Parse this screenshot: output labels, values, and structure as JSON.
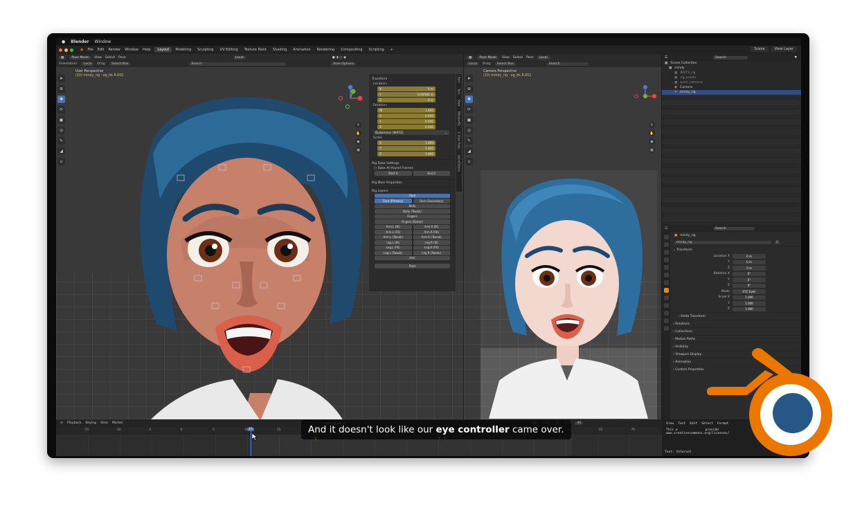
{
  "macbar": {
    "apple": "",
    "app": "Blender",
    "menu": "Window"
  },
  "topbar": {
    "menus": [
      "File",
      "Edit",
      "Render",
      "Window",
      "Help"
    ],
    "workspaces": [
      "Layout",
      "Modeling",
      "Sculpting",
      "UV Editing",
      "Texture Paint",
      "Shading",
      "Animation",
      "Rendering",
      "Compositing",
      "Scripting"
    ],
    "active_workspace": "Layout",
    "scene": "Scene",
    "view_layer": "View Layer"
  },
  "left_viewport": {
    "mode": "Pose Mode",
    "menus": [
      "View",
      "Select",
      "Pose"
    ],
    "orientation_label": "Orientation:",
    "orientation": "Local",
    "drag_label": "Drag:",
    "drag": "Select Box",
    "transform": "Local",
    "search_placeholder": "Search",
    "perspective": "User Perspective",
    "object_line": "(10) mindy_rig : eg_bk.R.002",
    "pose_options": "Pose Options"
  },
  "right_viewport": {
    "mode": "Pose Mode",
    "menus": [
      "View",
      "Select",
      "Pose"
    ],
    "orientation": "Local",
    "drag_label": "Drag:",
    "drag": "Select Box",
    "transform": "Local",
    "search_placeholder": "Search",
    "perspective": "Camera Perspective",
    "object_line": "(10) mindy_rig : eg_bk.R.002"
  },
  "npanel": {
    "transform_title": "Transform",
    "location_label": "Location:",
    "location": [
      {
        "k": "X",
        "v": "0 m"
      },
      {
        "k": "Y",
        "v": "0.00582 m"
      },
      {
        "k": "Z",
        "v": "0 m"
      }
    ],
    "rotation_label": "Rotation:",
    "rotation": [
      {
        "k": "W",
        "v": "1.000"
      },
      {
        "k": "X",
        "v": "0.000"
      },
      {
        "k": "Y",
        "v": "0.000"
      },
      {
        "k": "Z",
        "v": "0.000"
      }
    ],
    "rotation_mode": "Quaternion (WXYZ)",
    "scale_label": "Scale:",
    "scale": [
      {
        "k": "X",
        "v": "1.000"
      },
      {
        "k": "Y",
        "v": "1.000"
      },
      {
        "k": "Z",
        "v": "1.000"
      }
    ],
    "rig_bake_title": "Rig Bake Settings",
    "bake_all": "Bake All Keyed Frames",
    "start": "Start",
    "start_val": "0",
    "end": "End",
    "end_val": "0",
    "rig_main_title": "Rig Main Properties",
    "rig_layers_title": "Rig Layers",
    "layers": {
      "face": "Face",
      "face_primary": "Face (Primary)",
      "face_secondary": "Face (Secondary)",
      "body": "Body",
      "body_tweak": "Body (Tweak)",
      "fingers": "Fingers",
      "fingers_detail": "Fingers (Detail)",
      "arm_l_ik": "Arm.L (IK)",
      "arm_r_ik": "Arm.R (IK)",
      "arm_l_fk": "Arm.L (FK)",
      "arm_r_fk": "Arm.R (FK)",
      "arm_l_tweak": "Arm.L (Tweak)",
      "arm_r_tweak": "Arm.R (Tweak)",
      "leg_l_ik": "Leg.L (IK)",
      "leg_r_ik": "Leg.R (IK)",
      "leg_l_fk": "Leg.L (FK)",
      "leg_r_fk": "Leg.R (FK)",
      "leg_l_tweak": "Leg.L (Tweak)",
      "leg_r_tweak": "Leg.R (Tweak)",
      "hair": "Hair",
      "root": "Root"
    },
    "tabs": [
      "Item",
      "Tool",
      "View",
      "BlenderKit",
      "3. Pose Tools",
      "AnimEditors"
    ]
  },
  "outliner": {
    "search_placeholder": "Search",
    "rows": [
      "Scene Collection",
      "mindy",
      "WGTS_rig",
      "rig_assets",
      "pose_cameras",
      "Camera",
      "mindy_rig"
    ]
  },
  "properties": {
    "search_placeholder": "Search",
    "object": "mindy_rig",
    "data": "mindy_rig",
    "users": "2",
    "transform_title": "Transform",
    "location": [
      {
        "k": "Location X",
        "v": "0 m"
      },
      {
        "k": "Y",
        "v": "0 m"
      },
      {
        "k": "Z",
        "v": "0 m"
      }
    ],
    "rotation": [
      {
        "k": "Rotation X",
        "v": "0°"
      },
      {
        "k": "Y",
        "v": "0°"
      },
      {
        "k": "Z",
        "v": "0°"
      }
    ],
    "mode_label": "Mode",
    "mode": "XYZ Euler",
    "scale": [
      {
        "k": "Scale X",
        "v": "1.000"
      },
      {
        "k": "Y",
        "v": "1.000"
      },
      {
        "k": "Z",
        "v": "1.000"
      }
    ],
    "sections": [
      "Delta Transform",
      "Relations",
      "Collections",
      "Motion Paths",
      "Visibility",
      "Viewport Display",
      "Animation",
      "Custom Properties"
    ]
  },
  "timeline": {
    "menus": [
      "Playback",
      "Keying",
      "View",
      "Marker"
    ],
    "current_frame": "10",
    "start_label": "Start",
    "start": "1",
    "end_label": "End",
    "end": "40",
    "ruler": [
      "-15",
      "-10",
      "-5",
      "0",
      "5",
      "10",
      "15",
      "20",
      "25",
      "30",
      "35",
      "40",
      "45",
      "50",
      "55",
      "60",
      "65",
      "70"
    ]
  },
  "info": {
    "menus": [
      "View",
      "Text",
      "Edit",
      "Select",
      "Format",
      "Templates"
    ],
    "lines": [
      "This w",
      "provide",
      "www.creativecommons.org/licenses/"
    ],
    "footer": "Text: Internal"
  },
  "subtitle": {
    "pre": "And it doesn't look like our ",
    "bold": "eye controller",
    "post": " came over."
  },
  "colors": {
    "accent": "#4772b3",
    "blender_orange": "#eb7700",
    "blender_blue": "#265787",
    "field_yellow": "#8b7b2e"
  }
}
